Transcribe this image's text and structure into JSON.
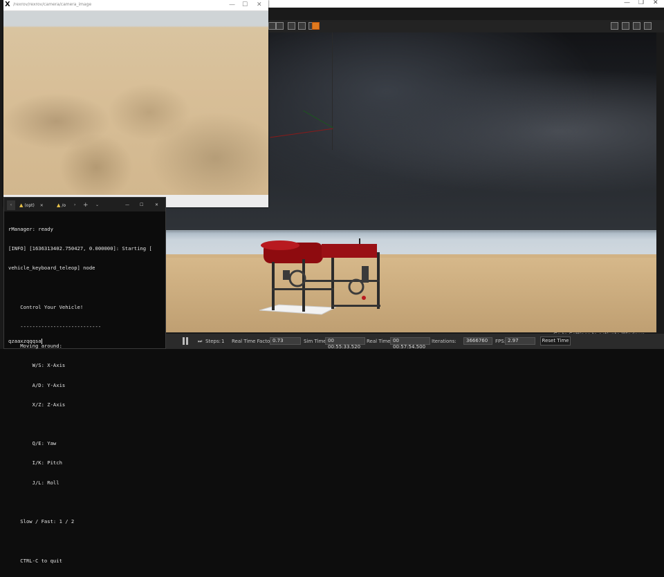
{
  "gazebo": {
    "window_controls": [
      "—",
      "❐",
      "✕"
    ],
    "toolbar_icons": [
      "select-icon",
      "translate-icon",
      "rotate-icon",
      "scale-icon",
      "undo-icon",
      "box-icon"
    ],
    "right_toolbar_icons": [
      "camera-icon",
      "log-icon",
      "plot-icon",
      "video-icon"
    ],
    "simbar": {
      "steps_label": "Steps:",
      "steps_value": "1",
      "rtf_label": "Real Time Factor:",
      "rtf_value": "0.73",
      "sim_time_label": "Sim Time:",
      "sim_time_value": "00 00:55:33.520",
      "real_time_label": "Real Time:",
      "real_time_value": "00 00:57:54.500",
      "iterations_label": "Iterations:",
      "iterations_value": "3666760",
      "fps_label": "FPS:",
      "fps_value": "2.97",
      "reset_label": "Reset Time"
    },
    "activate_notice": "Go to Settings to activate Windows."
  },
  "camera_window": {
    "title": "/rexrov/rexrov/camera/camera_image",
    "controls": [
      "—",
      "☐",
      "✕"
    ]
  },
  "terminal": {
    "tabs": [
      {
        "label": "(opt)"
      },
      {
        "label": "/o"
      }
    ],
    "controls": [
      "—",
      "☐",
      "✕"
    ],
    "lines": [
      "rManager: ready",
      "[INFO] [1636313402.750427, 0.000000]: Starting [",
      "vehicle_keyboard_teleop] node",
      "",
      "    Control Your Vehicle!",
      "    ---------------------------",
      "    Moving around:",
      "        W/S: X-Axis",
      "        A/D: Y-Axis",
      "        X/Z: Z-Axis",
      "",
      "        Q/E: Yaw",
      "        I/K: Pitch",
      "        J/L: Roll",
      "",
      "    Slow / Fast: 1 / 2",
      "",
      "    CTRL-C to quit"
    ],
    "input": "qzaaxzqqqsa"
  }
}
